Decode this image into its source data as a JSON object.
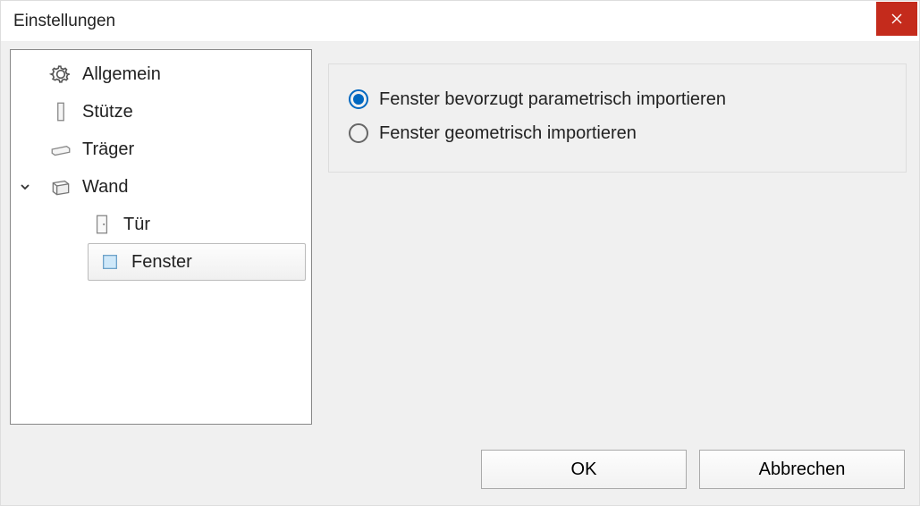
{
  "dialog": {
    "title": "Einstellungen"
  },
  "tree": {
    "allgemein": "Allgemein",
    "stuetze": "Stütze",
    "traeger": "Träger",
    "wand": "Wand",
    "tuer": "Tür",
    "fenster": "Fenster"
  },
  "options": {
    "parametric": "Fenster bevorzugt parametrisch importieren",
    "geometric": "Fenster geometrisch importieren"
  },
  "buttons": {
    "ok": "OK",
    "cancel": "Abbrechen"
  }
}
